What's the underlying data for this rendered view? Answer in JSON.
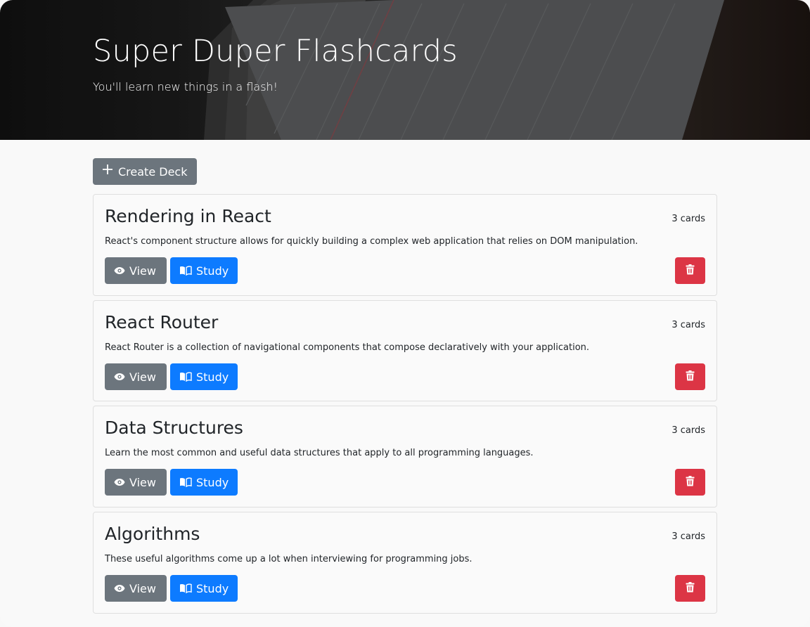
{
  "header": {
    "title": "Super Duper Flashcards",
    "subtitle": "You'll learn new things in a flash!"
  },
  "toolbar": {
    "create_label": "Create Deck",
    "create_icon": "plus-icon"
  },
  "decks": [
    {
      "name": "Rendering in React",
      "count": "3 cards",
      "description": "React's component structure allows for quickly building a complex web application that relies on DOM manipulation.",
      "view_label": "View",
      "study_label": "Study"
    },
    {
      "name": "React Router",
      "count": "3 cards",
      "description": "React Router is a collection of navigational components that compose declaratively with your application.",
      "view_label": "View",
      "study_label": "Study"
    },
    {
      "name": "Data Structures",
      "count": "3 cards",
      "description": "Learn the most common and useful data structures that apply to all programming languages.",
      "view_label": "View",
      "study_label": "Study"
    },
    {
      "name": "Algorithms",
      "count": "3 cards",
      "description": "These useful algorithms come up a lot when interviewing for programming jobs.",
      "view_label": "View",
      "study_label": "Study"
    }
  ],
  "icons": {
    "view": "eye-icon",
    "study": "book-icon",
    "delete": "trash-icon"
  },
  "colors": {
    "secondary": "#6c757d",
    "primary": "#0d7bff",
    "danger": "#dc3545"
  }
}
